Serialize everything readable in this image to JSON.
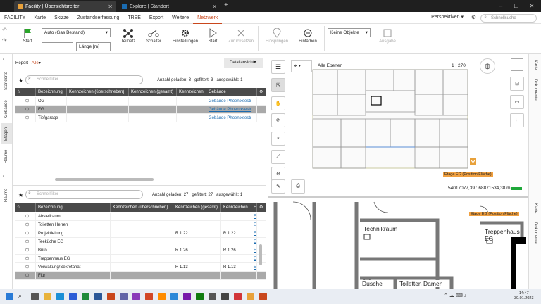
{
  "tabs": [
    {
      "label": "Facility | Übersichtsreiter",
      "active": true
    },
    {
      "label": "Explore | Standort",
      "active": false
    }
  ],
  "menu": [
    "FACILITY",
    "Karte",
    "Skizze",
    "Zustandserfassung",
    "TREE",
    "Export",
    "Weitere",
    "Netzwerk"
  ],
  "menu_active": "Netzwerk",
  "perspectives": "Perspektiven",
  "quicksearch_placeholder": "Schnellsuche",
  "toolbar": {
    "start1": "Start",
    "select_value": "Auto (Gas Bestand)",
    "length_value": "Länge [m]",
    "teilnetz": "Teilnetz",
    "schalter": "Schalter",
    "einstellungen": "Einstellungen",
    "start2": "Start",
    "zuruecksetzen": "Zurücksetzen",
    "hinspringen": "Hinspringen",
    "einfaerben": "Einfärben",
    "keine_objekte": "Keine Objekte",
    "ausgabe": "Ausgabe"
  },
  "left_rail": [
    "Standorte",
    "Gebäude",
    "Etagen",
    "Räume",
    "Räume"
  ],
  "report": {
    "label": "Report :",
    "value": "Alle",
    "detail": "Detailansicht"
  },
  "grid1": {
    "filter_placeholder": "Schnellfilter",
    "loaded_label": "Anzahl geladen:",
    "loaded": "3",
    "filtered_label": "gefiltert:",
    "filtered": "3",
    "selected_label": "ausgewählt:",
    "selected": "1",
    "columns": [
      "Bezeichnung",
      "Kennzeichen (überschrieben)",
      "Kennzeichen (gesamt)",
      "Kennzeichen",
      "Gebäude"
    ],
    "rows": [
      {
        "name": "OG",
        "gebaeude": "Gebäude Phoenixsestr",
        "sel": false
      },
      {
        "name": "EG",
        "gebaeude": "Gebäude Phoenixsestr",
        "sel": true
      },
      {
        "name": "Tiefgarage",
        "gebaeude": "Gebäude Phoenixsestr",
        "sel": false
      }
    ]
  },
  "grid2": {
    "filter_placeholder": "Schnellfilter",
    "loaded_label": "Anzahl geladen:",
    "loaded": "27",
    "filtered_label": "gefiltert:",
    "filtered": "27",
    "selected_label": "ausgewählt:",
    "selected": "1",
    "columns": [
      "Bezeichnung",
      "Kennzeichen (überschrieben)",
      "Kennzeichen (gesamt)",
      "Kennzeichen",
      "Ei"
    ],
    "rows": [
      {
        "name": "Abstellraum",
        "kg": "",
        "k": "",
        "e": "El",
        "sel": false
      },
      {
        "name": "Toiletten Herren",
        "kg": "",
        "k": "",
        "e": "El",
        "sel": false
      },
      {
        "name": "Projektleitung",
        "kg": "R 1.22",
        "k": "R 1.22",
        "e": "El",
        "sel": false
      },
      {
        "name": "Teeküche EG",
        "kg": "",
        "k": "",
        "e": "El",
        "sel": false
      },
      {
        "name": "Büro",
        "kg": "R 1.26",
        "k": "R 1.26",
        "e": "El",
        "sel": false
      },
      {
        "name": "Treppenhaus EG",
        "kg": "",
        "k": "",
        "e": "El",
        "sel": false
      },
      {
        "name": "Verwaltung/Sekretariat",
        "kg": "R 1.13",
        "k": "R 1.13",
        "e": "El",
        "sel": false
      },
      {
        "name": "Flur",
        "kg": "",
        "k": "",
        "e": "",
        "sel": true
      }
    ]
  },
  "map": {
    "layers": "Alle Ebenen",
    "scale": "1 : 270",
    "floor_tag": "Etage EG (Position Fläche)",
    "coords": "54017077,39 : 68871534,38 m",
    "room_labels": [
      "Technikraum",
      "Treppenhaus EG",
      "Dusche",
      "Toiletten Damen"
    ]
  },
  "right_rail": [
    "Karte",
    "Dokumente"
  ],
  "right_rail2": [
    "Karte",
    "Dokumente"
  ],
  "clock": {
    "time": "14:47",
    "date": "30.01.2023"
  }
}
